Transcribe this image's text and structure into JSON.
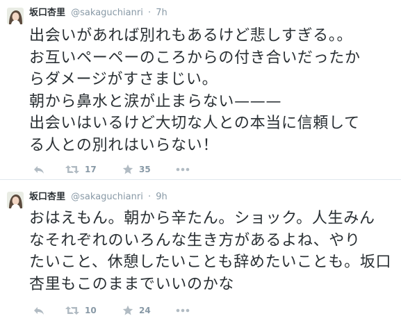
{
  "tweets": [
    {
      "fullname": "坂口杏里",
      "username": "@sakaguchianri",
      "separator": "·",
      "time": "7h",
      "text_lines": [
        "出会いがあれば別れもあるけど悲しすぎる。。",
        "お互いペーペーのころからの付き合いだったか",
        "らダメージがすさまじい。",
        "朝から鼻水と涙が止まらない———",
        "出会いはいるけど大切な人との本当に信頼して",
        "る人との別れはいらない！"
      ],
      "retweets": "17",
      "favorites": "35",
      "icons": [
        "reply-icon",
        "retweet-icon",
        "star-icon",
        "more-icon"
      ]
    },
    {
      "fullname": "坂口杏里",
      "username": "@sakaguchianri",
      "separator": "·",
      "time": "9h",
      "text_lines": [
        "おはえもん。朝から辛たん。ショック。人生みん",
        "なそれぞれのいろんな生き方があるよね、やり",
        "たいこと、休憩したいことも辞めたいことも。坂口",
        "杏里もこのままでいいのかな"
      ],
      "retweets": "10",
      "favorites": "24",
      "icons": [
        "reply-icon",
        "retweet-icon",
        "star-icon",
        "more-icon"
      ]
    }
  ],
  "colors": {
    "text": "#292f33",
    "muted": "#8899a6",
    "icon": "#b1bbc3",
    "divider": "#e1e8ed"
  }
}
